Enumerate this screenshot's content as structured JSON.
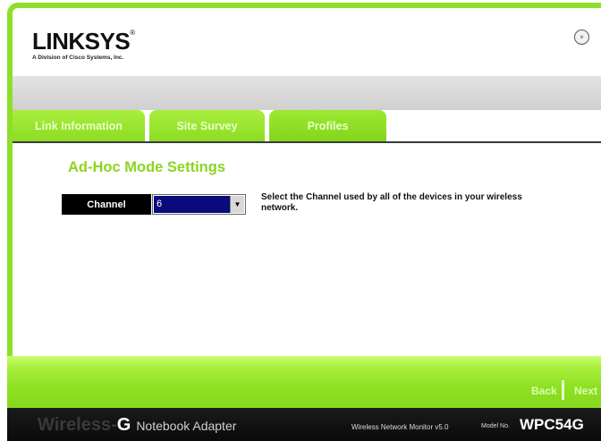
{
  "header": {
    "logo": "LINKSYS",
    "logo_reg": "®",
    "logo_sub": "A Division of Cisco Systems, Inc.",
    "close_label": "⊗"
  },
  "tabs": [
    {
      "label": "Link Information"
    },
    {
      "label": "Site Survey"
    },
    {
      "label": "Profiles"
    }
  ],
  "main": {
    "title": "Ad-Hoc Mode Settings",
    "channel_label": "Channel",
    "channel_value": "6",
    "help_text": "Select the Channel used by all of the devices in your wireless network."
  },
  "footer": {
    "back": "Back",
    "next": "Next",
    "brand_wireless": "Wireless-",
    "brand_g": "G",
    "brand_product": "Notebook Adapter",
    "monitor_version": "Wireless Network Monitor v5.0",
    "model_label": "Model No.",
    "model_no": "WPC54G"
  },
  "colors": {
    "accent_green": "#8ede2a",
    "title_green": "#8cd41f",
    "select_highlight": "#0a0a7c"
  },
  "icons": {
    "close": "close-circle-icon",
    "dropdown": "chevron-down-icon"
  }
}
